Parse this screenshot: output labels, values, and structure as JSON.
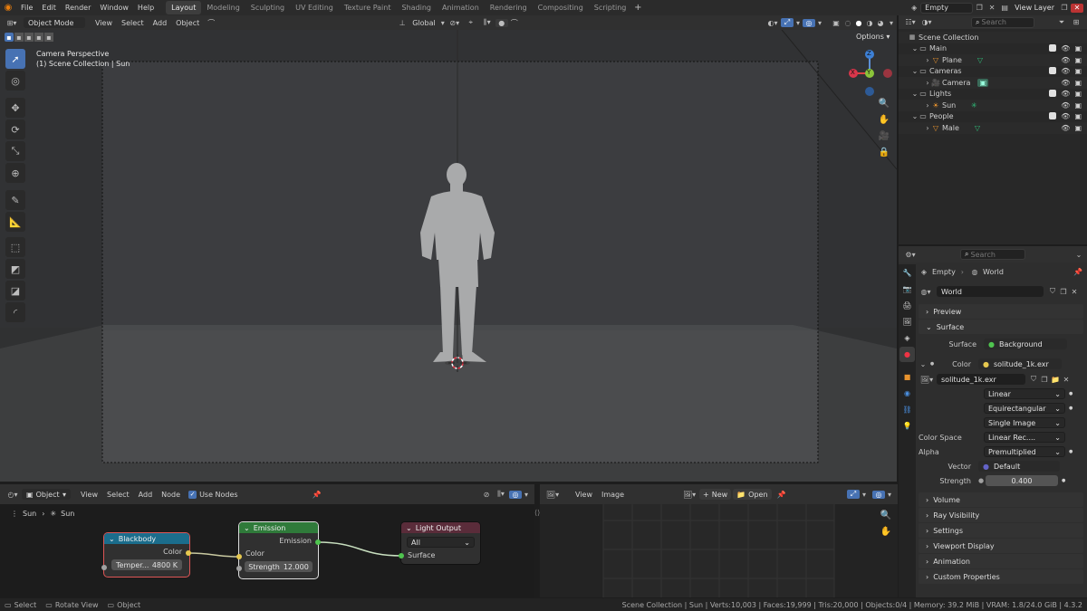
{
  "menu": [
    "File",
    "Edit",
    "Render",
    "Window",
    "Help"
  ],
  "workspaces": [
    "Layout",
    "Modeling",
    "Sculpting",
    "UV Editing",
    "Texture Paint",
    "Shading",
    "Animation",
    "Rendering",
    "Compositing",
    "Scripting"
  ],
  "active_workspace": "Layout",
  "scene_field": "Empty",
  "view_layer": "View Layer",
  "viewport": {
    "mode": "Object Mode",
    "menus": [
      "View",
      "Select",
      "Add",
      "Object"
    ],
    "transform": "Global",
    "options": "Options",
    "overlay_line1": "Camera Perspective",
    "overlay_line2": "(1) Scene Collection | Sun",
    "gizmo": {
      "x": "X",
      "y": "Y",
      "z": "Z"
    }
  },
  "outliner": {
    "search_placeholder": "Search",
    "rows": [
      {
        "label": "Scene Collection",
        "indent": 0,
        "type": "scene"
      },
      {
        "label": "Main",
        "indent": 1,
        "type": "collection"
      },
      {
        "label": "Plane",
        "indent": 2,
        "type": "mesh"
      },
      {
        "label": "Cameras",
        "indent": 1,
        "type": "collection"
      },
      {
        "label": "Camera",
        "indent": 2,
        "type": "camera"
      },
      {
        "label": "Lights",
        "indent": 1,
        "type": "collection"
      },
      {
        "label": "Sun",
        "indent": 2,
        "type": "light"
      },
      {
        "label": "People",
        "indent": 1,
        "type": "collection"
      },
      {
        "label": "Male",
        "indent": 2,
        "type": "mesh"
      }
    ]
  },
  "properties": {
    "search_placeholder": "Search",
    "breadcrumb": [
      "Empty",
      "World"
    ],
    "world_name": "World",
    "sections_top": [
      "Preview",
      "Surface"
    ],
    "surface_label": "Surface",
    "surface_value": "Background",
    "color_label": "Color",
    "color_value": "solitude_1k.exr",
    "image_name": "solitude_1k.exr",
    "interpolation": "Linear",
    "projection": "Equirectangular",
    "extension": "Single Image",
    "color_space_label": "Color Space",
    "color_space_value": "Linear Rec....",
    "alpha_label": "Alpha",
    "alpha_value": "Premultiplied",
    "vector_label": "Vector",
    "vector_value": "Default",
    "strength_label": "Strength",
    "strength_value": "0.400",
    "sections_bottom": [
      "Volume",
      "Ray Visibility",
      "Settings",
      "Viewport Display",
      "Animation",
      "Custom Properties"
    ]
  },
  "node_editor": {
    "type": "Object",
    "menus": [
      "View",
      "Select",
      "Add",
      "Node"
    ],
    "use_nodes": "Use Nodes",
    "breadcrumb": [
      "Sun",
      "Sun"
    ],
    "blackbody": {
      "title": "Blackbody",
      "out": "Color",
      "field_label": "Temper...",
      "field_value": "4800 K"
    },
    "emission": {
      "title": "Emission",
      "out": "Emission",
      "in_color": "Color",
      "strength_label": "Strength",
      "strength_value": "12.000"
    },
    "light_output": {
      "title": "Light Output",
      "target": "All",
      "in_surface": "Surface"
    }
  },
  "image_editor": {
    "menus": [
      "View",
      "Image"
    ],
    "new_label": "New",
    "open_label": "Open"
  },
  "status": {
    "left": [
      {
        "label": "Select"
      },
      {
        "label": "Rotate View"
      },
      {
        "label": "Object"
      }
    ],
    "right": "Scene Collection | Sun | Verts:10,003 | Faces:19,999 | Tris:20,000 | Objects:0/4 | Memory: 39.2 MiB | VRAM: 1.8/24.0 GiB | 4.3.2"
  },
  "colors": {
    "accent": "#4772b3",
    "blackbody_header": "#1b6d8c",
    "emission_header": "#2f7a3a",
    "output_header": "#5a2c3a"
  }
}
